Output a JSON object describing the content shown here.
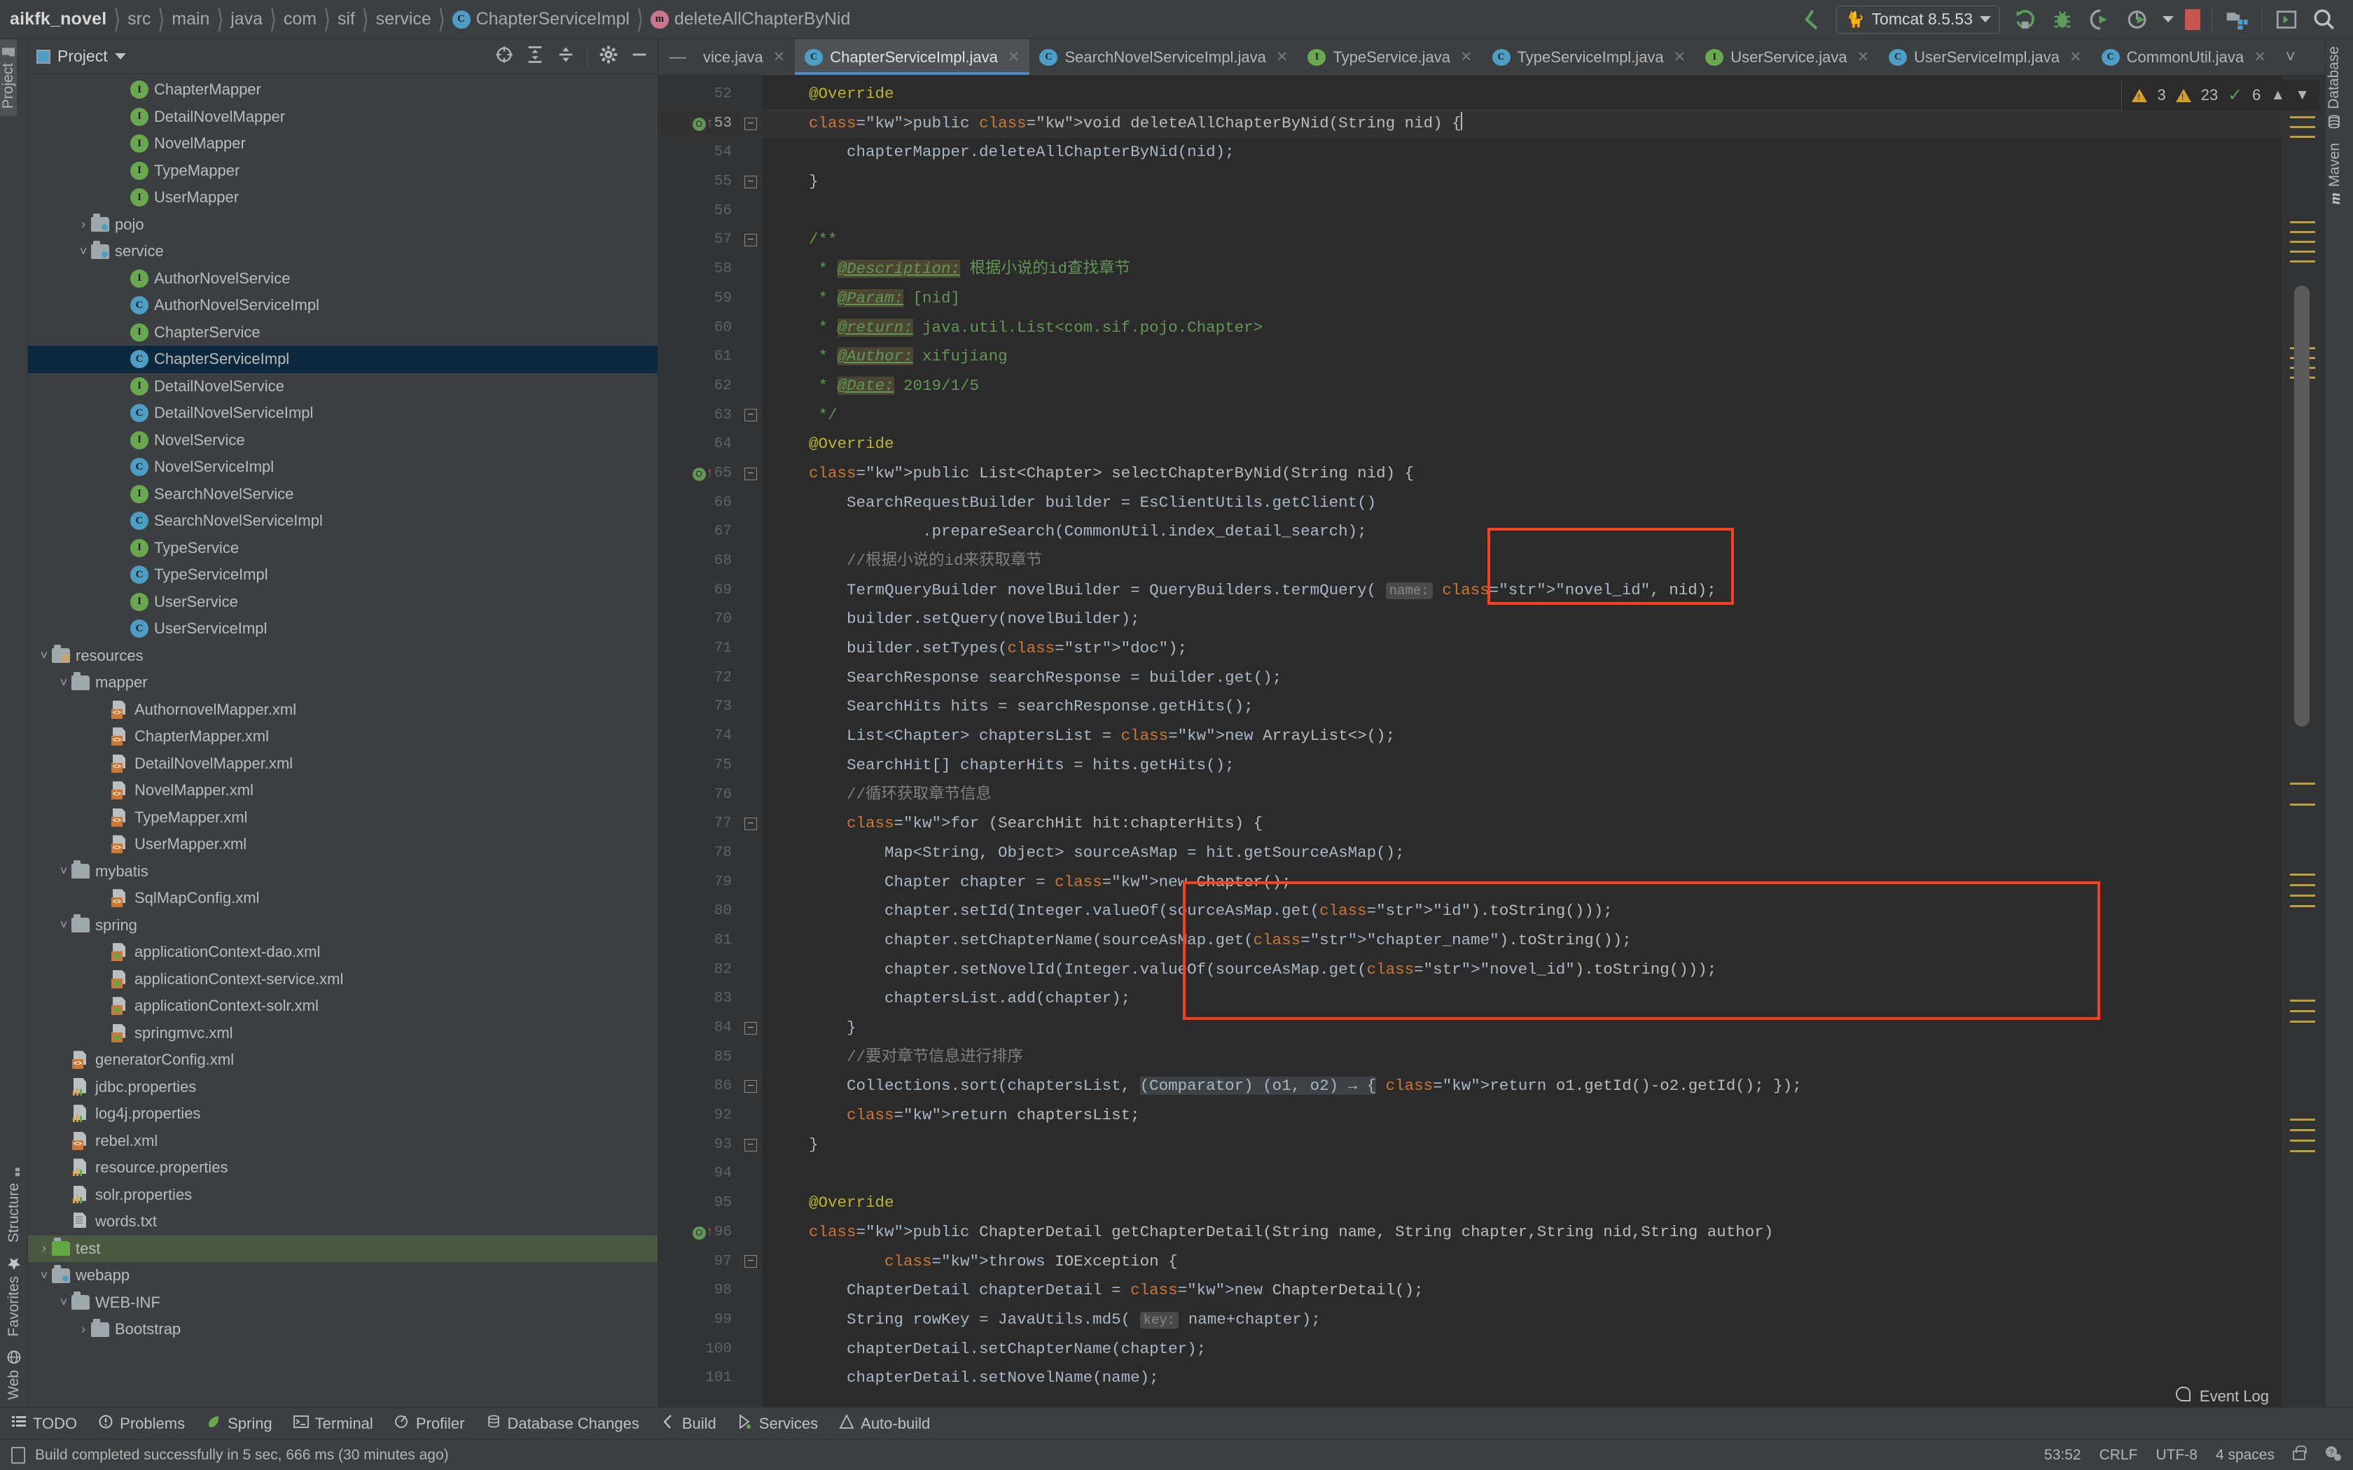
{
  "breadcrumb": {
    "root": "aikfk_novel",
    "segments": [
      "src",
      "main",
      "java",
      "com",
      "sif",
      "service"
    ],
    "class": "ChapterServiceImpl",
    "method": "deleteAllChapterByNid"
  },
  "toolbar": {
    "run_config": "Tomcat 8.5.53",
    "icons": [
      "back-icon",
      "run-icon",
      "debug-icon",
      "run-coverage-icon",
      "profile-icon",
      "stop-icon",
      "project-structure-icon",
      "console-icon",
      "search-everywhere-icon"
    ]
  },
  "left_strip": {
    "top": [
      "Project"
    ],
    "bottom": [
      "Structure",
      "Favorites",
      "Web"
    ]
  },
  "right_strip": {
    "items": [
      "Database",
      "Maven"
    ]
  },
  "project_panel": {
    "title": "Project",
    "tools": [
      "locate-icon",
      "expand-all-icon",
      "collapse-all-icon",
      "settings-icon",
      "hide-icon"
    ],
    "tree": [
      {
        "label": "ChapterMapper",
        "indent": 7,
        "icon": "interface",
        "arrow": "none"
      },
      {
        "label": "DetailNovelMapper",
        "indent": 7,
        "icon": "interface",
        "arrow": "none"
      },
      {
        "label": "NovelMapper",
        "indent": 7,
        "icon": "interface",
        "arrow": "none"
      },
      {
        "label": "TypeMapper",
        "indent": 7,
        "icon": "interface",
        "arrow": "none"
      },
      {
        "label": "UserMapper",
        "indent": 7,
        "icon": "interface",
        "arrow": "none"
      },
      {
        "label": "pojo",
        "indent": 5,
        "icon": "folder-src",
        "arrow": "right"
      },
      {
        "label": "service",
        "indent": 5,
        "icon": "folder-src",
        "arrow": "down"
      },
      {
        "label": "AuthorNovelService",
        "indent": 7,
        "icon": "interface",
        "arrow": "none"
      },
      {
        "label": "AuthorNovelServiceImpl",
        "indent": 7,
        "icon": "class",
        "arrow": "none"
      },
      {
        "label": "ChapterService",
        "indent": 7,
        "icon": "interface",
        "arrow": "none"
      },
      {
        "label": "ChapterServiceImpl",
        "indent": 7,
        "icon": "class",
        "arrow": "none",
        "state": "selected"
      },
      {
        "label": "DetailNovelService",
        "indent": 7,
        "icon": "interface",
        "arrow": "none"
      },
      {
        "label": "DetailNovelServiceImpl",
        "indent": 7,
        "icon": "class",
        "arrow": "none"
      },
      {
        "label": "NovelService",
        "indent": 7,
        "icon": "interface",
        "arrow": "none"
      },
      {
        "label": "NovelServiceImpl",
        "indent": 7,
        "icon": "class",
        "arrow": "none"
      },
      {
        "label": "SearchNovelService",
        "indent": 7,
        "icon": "interface",
        "arrow": "none"
      },
      {
        "label": "SearchNovelServiceImpl",
        "indent": 7,
        "icon": "class",
        "arrow": "none"
      },
      {
        "label": "TypeService",
        "indent": 7,
        "icon": "interface",
        "arrow": "none"
      },
      {
        "label": "TypeServiceImpl",
        "indent": 7,
        "icon": "class",
        "arrow": "none"
      },
      {
        "label": "UserService",
        "indent": 7,
        "icon": "interface",
        "arrow": "none"
      },
      {
        "label": "UserServiceImpl",
        "indent": 7,
        "icon": "class",
        "arrow": "none"
      },
      {
        "label": "resources",
        "indent": 3,
        "icon": "folder-res",
        "arrow": "down"
      },
      {
        "label": "mapper",
        "indent": 4,
        "icon": "folder",
        "arrow": "down"
      },
      {
        "label": "AuthornovelMapper.xml",
        "indent": 6,
        "icon": "xml",
        "arrow": "none"
      },
      {
        "label": "ChapterMapper.xml",
        "indent": 6,
        "icon": "xml",
        "arrow": "none"
      },
      {
        "label": "DetailNovelMapper.xml",
        "indent": 6,
        "icon": "xml",
        "arrow": "none"
      },
      {
        "label": "NovelMapper.xml",
        "indent": 6,
        "icon": "xml",
        "arrow": "none"
      },
      {
        "label": "TypeMapper.xml",
        "indent": 6,
        "icon": "xml",
        "arrow": "none"
      },
      {
        "label": "UserMapper.xml",
        "indent": 6,
        "icon": "xml",
        "arrow": "none"
      },
      {
        "label": "mybatis",
        "indent": 4,
        "icon": "folder",
        "arrow": "down"
      },
      {
        "label": "SqlMapConfig.xml",
        "indent": 6,
        "icon": "xml",
        "arrow": "none"
      },
      {
        "label": "spring",
        "indent": 4,
        "icon": "folder",
        "arrow": "down"
      },
      {
        "label": "applicationContext-dao.xml",
        "indent": 6,
        "icon": "xml-spring",
        "arrow": "none"
      },
      {
        "label": "applicationContext-service.xml",
        "indent": 6,
        "icon": "xml-spring",
        "arrow": "none"
      },
      {
        "label": "applicationContext-solr.xml",
        "indent": 6,
        "icon": "xml-spring",
        "arrow": "none"
      },
      {
        "label": "springmvc.xml",
        "indent": 6,
        "icon": "xml-spring",
        "arrow": "none"
      },
      {
        "label": "generatorConfig.xml",
        "indent": 4,
        "icon": "xml",
        "arrow": "none"
      },
      {
        "label": "jdbc.properties",
        "indent": 4,
        "icon": "properties",
        "arrow": "none"
      },
      {
        "label": "log4j.properties",
        "indent": 4,
        "icon": "properties",
        "arrow": "none"
      },
      {
        "label": "rebel.xml",
        "indent": 4,
        "icon": "xml",
        "arrow": "none"
      },
      {
        "label": "resource.properties",
        "indent": 4,
        "icon": "properties",
        "arrow": "none"
      },
      {
        "label": "solr.properties",
        "indent": 4,
        "icon": "properties",
        "arrow": "none"
      },
      {
        "label": "words.txt",
        "indent": 4,
        "icon": "text",
        "arrow": "none"
      },
      {
        "label": "test",
        "indent": 3,
        "icon": "folder-test",
        "arrow": "right",
        "state": "highlighted"
      },
      {
        "label": "webapp",
        "indent": 3,
        "icon": "folder-src",
        "arrow": "down"
      },
      {
        "label": "WEB-INF",
        "indent": 4,
        "icon": "folder",
        "arrow": "down"
      },
      {
        "label": "Bootstrap",
        "indent": 5,
        "icon": "folder",
        "arrow": "right"
      }
    ]
  },
  "editor_tabs": [
    {
      "label": "vice.java",
      "icon": "none",
      "active": false
    },
    {
      "label": "ChapterServiceImpl.java",
      "icon": "class",
      "active": true
    },
    {
      "label": "SearchNovelServiceImpl.java",
      "icon": "class",
      "active": false
    },
    {
      "label": "TypeService.java",
      "icon": "interface",
      "active": false
    },
    {
      "label": "TypeServiceImpl.java",
      "icon": "class",
      "active": false
    },
    {
      "label": "UserService.java",
      "icon": "interface",
      "active": false
    },
    {
      "label": "UserServiceImpl.java",
      "icon": "class",
      "active": false
    },
    {
      "label": "CommonUtil.java",
      "icon": "class",
      "active": false
    }
  ],
  "inspection": {
    "warnings1": "3",
    "warnings2": "23",
    "ok": "6"
  },
  "code": {
    "lines": [
      {
        "n": "52",
        "mark": "",
        "fold": "",
        "cur": false
      },
      {
        "n": "53",
        "mark": "override",
        "fold": "open",
        "cur": true
      },
      {
        "n": "54",
        "mark": "",
        "fold": "",
        "cur": false
      },
      {
        "n": "55",
        "mark": "",
        "fold": "close",
        "cur": false
      },
      {
        "n": "56",
        "mark": "",
        "fold": "",
        "cur": false
      },
      {
        "n": "57",
        "mark": "",
        "fold": "open",
        "cur": false
      },
      {
        "n": "58",
        "mark": "",
        "fold": "",
        "cur": false
      },
      {
        "n": "59",
        "mark": "",
        "fold": "",
        "cur": false
      },
      {
        "n": "60",
        "mark": "",
        "fold": "",
        "cur": false
      },
      {
        "n": "61",
        "mark": "",
        "fold": "",
        "cur": false
      },
      {
        "n": "62",
        "mark": "",
        "fold": "",
        "cur": false
      },
      {
        "n": "63",
        "mark": "",
        "fold": "close",
        "cur": false
      },
      {
        "n": "64",
        "mark": "",
        "fold": "",
        "cur": false
      },
      {
        "n": "65",
        "mark": "override",
        "fold": "open",
        "cur": false
      },
      {
        "n": "66",
        "mark": "",
        "fold": "",
        "cur": false
      },
      {
        "n": "67",
        "mark": "",
        "fold": "",
        "cur": false
      },
      {
        "n": "68",
        "mark": "",
        "fold": "",
        "cur": false
      },
      {
        "n": "69",
        "mark": "",
        "fold": "",
        "cur": false
      },
      {
        "n": "70",
        "mark": "",
        "fold": "",
        "cur": false
      },
      {
        "n": "71",
        "mark": "",
        "fold": "",
        "cur": false
      },
      {
        "n": "72",
        "mark": "",
        "fold": "",
        "cur": false
      },
      {
        "n": "73",
        "mark": "",
        "fold": "",
        "cur": false
      },
      {
        "n": "74",
        "mark": "",
        "fold": "",
        "cur": false
      },
      {
        "n": "75",
        "mark": "",
        "fold": "",
        "cur": false
      },
      {
        "n": "76",
        "mark": "",
        "fold": "",
        "cur": false
      },
      {
        "n": "77",
        "mark": "",
        "fold": "open",
        "cur": false
      },
      {
        "n": "78",
        "mark": "",
        "fold": "",
        "cur": false
      },
      {
        "n": "79",
        "mark": "",
        "fold": "",
        "cur": false
      },
      {
        "n": "80",
        "mark": "",
        "fold": "",
        "cur": false
      },
      {
        "n": "81",
        "mark": "",
        "fold": "",
        "cur": false
      },
      {
        "n": "82",
        "mark": "",
        "fold": "",
        "cur": false
      },
      {
        "n": "83",
        "mark": "",
        "fold": "",
        "cur": false
      },
      {
        "n": "84",
        "mark": "",
        "fold": "close",
        "cur": false
      },
      {
        "n": "85",
        "mark": "",
        "fold": "",
        "cur": false
      },
      {
        "n": "86",
        "mark": "",
        "fold": "open",
        "cur": false
      },
      {
        "n": "92",
        "mark": "",
        "fold": "",
        "cur": false
      },
      {
        "n": "93",
        "mark": "",
        "fold": "close",
        "cur": false
      },
      {
        "n": "94",
        "mark": "",
        "fold": "",
        "cur": false
      },
      {
        "n": "95",
        "mark": "",
        "fold": "",
        "cur": false
      },
      {
        "n": "96",
        "mark": "override",
        "fold": "",
        "cur": false
      },
      {
        "n": "97",
        "mark": "",
        "fold": "open",
        "cur": false
      },
      {
        "n": "98",
        "mark": "",
        "fold": "",
        "cur": false
      },
      {
        "n": "99",
        "mark": "",
        "fold": "",
        "cur": false
      },
      {
        "n": "100",
        "mark": "",
        "fold": "",
        "cur": false
      },
      {
        "n": "101",
        "mark": "",
        "fold": "",
        "cur": false
      }
    ],
    "text": [
      "    @Override",
      "    public void deleteAllChapterByNid(String nid) {",
      "        chapterMapper.deleteAllChapterByNid(nid);",
      "    }",
      "",
      "    /**",
      "     * @Description: 根据小说的id查找章节",
      "     * @Param: [nid]",
      "     * @return: java.util.List<com.sif.pojo.Chapter>",
      "     * @Author: xifujiang",
      "     * @Date: 2019/1/5",
      "     */",
      "    @Override",
      "    public List<Chapter> selectChapterByNid(String nid) {",
      "        SearchRequestBuilder builder = EsClientUtils.getClient()",
      "                .prepareSearch(CommonUtil.index_detail_search);",
      "        //根据小说的id来获取章节",
      "        TermQueryBuilder novelBuilder = QueryBuilders.termQuery( name: \"novel_id\", nid);",
      "        builder.setQuery(novelBuilder);",
      "        builder.setTypes(\"doc\");",
      "        SearchResponse searchResponse = builder.get();",
      "        SearchHits hits = searchResponse.getHits();",
      "        List<Chapter> chaptersList = new ArrayList<>();",
      "        SearchHit[] chapterHits = hits.getHits();",
      "        //循环获取章节信息",
      "        for (SearchHit hit:chapterHits) {",
      "            Map<String, Object> sourceAsMap = hit.getSourceAsMap();",
      "            Chapter chapter = new Chapter();",
      "            chapter.setId(Integer.valueOf(sourceAsMap.get(\"id\").toString()));",
      "            chapter.setChapterName(sourceAsMap.get(\"chapter_name\").toString());",
      "            chapter.setNovelId(Integer.valueOf(sourceAsMap.get(\"novel_id\").toString()));",
      "            chaptersList.add(chapter);",
      "        }",
      "        //要对章节信息进行排序",
      "        Collections.sort(chaptersList, (Comparator) (o1, o2) -> { return o1.getId()-o2.getId(); });",
      "        return chaptersList;",
      "    }",
      "",
      "    @Override",
      "    public ChapterDetail getChapterDetail(String name, String chapter,String nid,String author)",
      "            throws IOException {",
      "        ChapterDetail chapterDetail = new ChapterDetail();",
      "        String rowKey = JavaUtils.md5( key: name+chapter);",
      "        chapterDetail.setChapterName(chapter);",
      "        chapterDetail.setNovelName(name);"
    ]
  },
  "annotations": {
    "boxes": [
      {
        "name": "novel-id-highlight-box",
        "color": "#fc3f1d"
      },
      {
        "name": "chapter-setters-highlight-box",
        "color": "#fc3f1d"
      }
    ]
  },
  "bottom_bar": {
    "items": [
      {
        "label": "TODO",
        "icon": "todo-icon"
      },
      {
        "label": "Problems",
        "icon": "problems-icon"
      },
      {
        "label": "Spring",
        "icon": "spring-leaf-icon"
      },
      {
        "label": "Terminal",
        "icon": "terminal-icon"
      },
      {
        "label": "Profiler",
        "icon": "profiler-icon"
      },
      {
        "label": "Database Changes",
        "icon": "database-icon"
      },
      {
        "label": "Build",
        "icon": "build-icon"
      },
      {
        "label": "Services",
        "icon": "services-icon"
      },
      {
        "label": "Auto-build",
        "icon": "autobuild-icon"
      }
    ],
    "event_log": "Event Log"
  },
  "status_bar": {
    "message": "Build completed successfully in 5 sec, 666 ms (30 minutes ago)",
    "position": "53:52",
    "line_sep": "CRLF",
    "encoding": "UTF-8",
    "indent": "4 spaces"
  }
}
